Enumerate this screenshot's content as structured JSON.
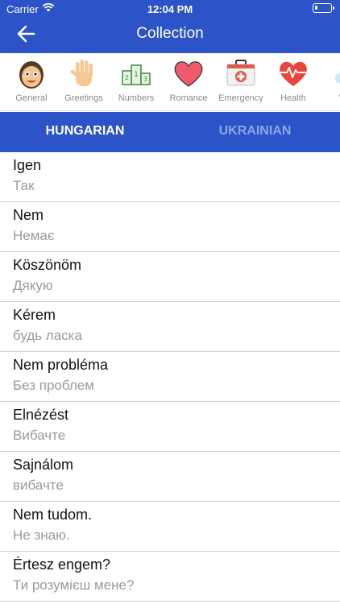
{
  "status_bar": {
    "carrier": "Carrier",
    "time": "12:04 PM",
    "battery_level": 0.2
  },
  "header": {
    "title": "Collection"
  },
  "categories": [
    {
      "label": "General",
      "icon": "face-icon"
    },
    {
      "label": "Greetings",
      "icon": "waving-hand-icon"
    },
    {
      "label": "Numbers",
      "icon": "podium-icon"
    },
    {
      "label": "Romance",
      "icon": "heart-icon"
    },
    {
      "label": "Emergency",
      "icon": "first-aid-kit-icon"
    },
    {
      "label": "Health",
      "icon": "heartbeat-icon"
    },
    {
      "label": "We",
      "icon": "weather-icon"
    }
  ],
  "tabs": {
    "source": "HUNGARIAN",
    "target": "UKRAINIAN"
  },
  "phrases": [
    {
      "source": "Igen",
      "target": "Так"
    },
    {
      "source": "Nem",
      "target": "Немає"
    },
    {
      "source": "Köszönöm",
      "target": "Дякую"
    },
    {
      "source": "Kérem",
      "target": "будь ласка"
    },
    {
      "source": "Nem probléma",
      "target": "Без проблем"
    },
    {
      "source": "Elnézést",
      "target": "Вибачте"
    },
    {
      "source": "Sajnálom",
      "target": "вибачте"
    },
    {
      "source": "Nem tudom.",
      "target": "Не знаю."
    },
    {
      "source": "Értesz engem?",
      "target": "Ти розумієш мене?"
    }
  ],
  "colors": {
    "primary": "#2c53c7",
    "inactive_tab": "#8ea6e8"
  }
}
